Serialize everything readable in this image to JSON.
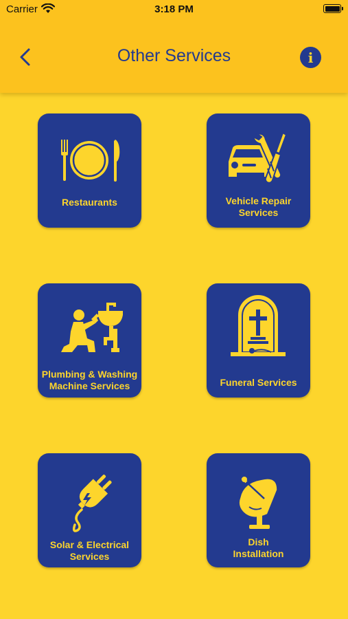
{
  "status_bar": {
    "carrier": "Carrier",
    "time": "3:18 PM"
  },
  "header": {
    "title": "Other Services",
    "back_icon": "chevron-left-icon",
    "info_icon": "info-icon",
    "info_glyph": "i"
  },
  "colors": {
    "header": "#FCC21E",
    "background": "#FDD52C",
    "tile": "#233A8F",
    "accent": "#FDD52C"
  },
  "services": [
    {
      "label": "Restaurants",
      "icon": "plate-cutlery-icon"
    },
    {
      "label": "Vehicle Repair\nServices",
      "icon": "car-repair-tools-icon"
    },
    {
      "label": "Plumbing & Washing\nMachine Services",
      "icon": "plumber-icon"
    },
    {
      "label": "Funeral Services",
      "icon": "tombstone-icon"
    },
    {
      "label": "Solar & Electrical\nServices",
      "icon": "electric-plug-icon"
    },
    {
      "label": "Dish\nInstallation",
      "icon": "satellite-dish-icon"
    }
  ]
}
